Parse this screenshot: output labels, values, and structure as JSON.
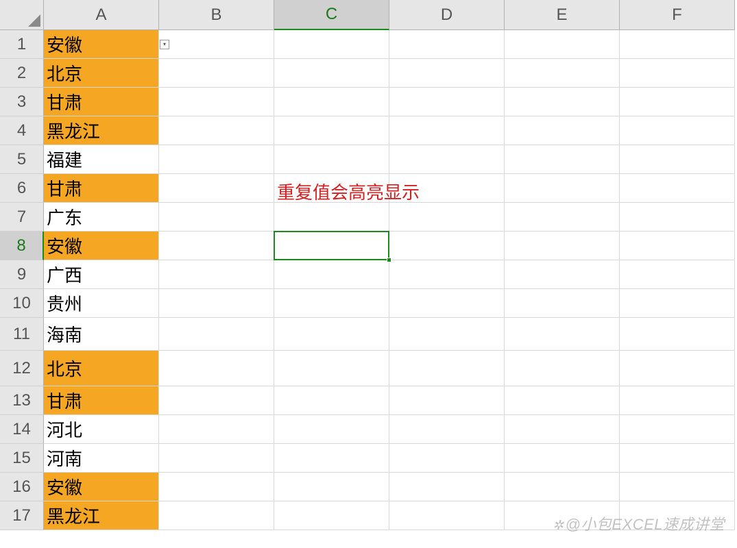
{
  "columns": [
    "A",
    "B",
    "C",
    "D",
    "E",
    "F"
  ],
  "active_column": "C",
  "active_row": 8,
  "active_cell": "C8",
  "rows": [
    {
      "num": 1,
      "height": "normal",
      "A": {
        "value": "安徽",
        "highlighted": true,
        "dropdown": true
      }
    },
    {
      "num": 2,
      "height": "normal",
      "A": {
        "value": "北京",
        "highlighted": true
      }
    },
    {
      "num": 3,
      "height": "normal",
      "A": {
        "value": "甘肃",
        "highlighted": true
      }
    },
    {
      "num": 4,
      "height": "normal",
      "A": {
        "value": "黑龙江",
        "highlighted": true
      }
    },
    {
      "num": 5,
      "height": "normal",
      "A": {
        "value": "福建",
        "highlighted": false
      }
    },
    {
      "num": 6,
      "height": "normal",
      "A": {
        "value": "甘肃",
        "highlighted": true
      },
      "C": {
        "value": "重复值会高亮显示",
        "red": true
      }
    },
    {
      "num": 7,
      "height": "normal",
      "A": {
        "value": "广东",
        "highlighted": false
      }
    },
    {
      "num": 8,
      "height": "normal",
      "A": {
        "value": "安徽",
        "highlighted": true
      }
    },
    {
      "num": 9,
      "height": "normal",
      "A": {
        "value": "广西",
        "highlighted": false
      }
    },
    {
      "num": 10,
      "height": "normal",
      "A": {
        "value": "贵州",
        "highlighted": false
      }
    },
    {
      "num": 11,
      "height": "tall",
      "A": {
        "value": "海南",
        "highlighted": false
      }
    },
    {
      "num": 12,
      "height": "tall2",
      "A": {
        "value": "北京",
        "highlighted": true
      }
    },
    {
      "num": 13,
      "height": "normal",
      "A": {
        "value": "甘肃",
        "highlighted": true
      }
    },
    {
      "num": 14,
      "height": "normal",
      "A": {
        "value": "河北",
        "highlighted": false
      }
    },
    {
      "num": 15,
      "height": "normal",
      "A": {
        "value": "河南",
        "highlighted": false
      }
    },
    {
      "num": 16,
      "height": "normal",
      "A": {
        "value": "安徽",
        "highlighted": true
      }
    },
    {
      "num": 17,
      "height": "normal",
      "A": {
        "value": "黑龙江",
        "highlighted": true
      }
    }
  ],
  "note_text": "重复值会高亮显示",
  "watermark": "@小包EXCEL速成讲堂",
  "colors": {
    "highlight": "#f5a623",
    "selection": "#1a8a1a",
    "red_text": "#d32020"
  }
}
